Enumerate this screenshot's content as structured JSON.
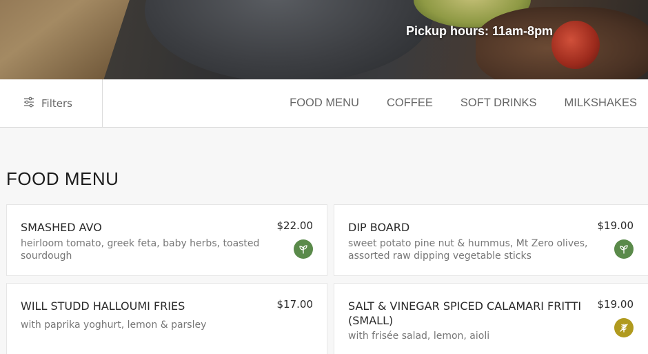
{
  "hero": {
    "pickup_text": "Pickup hours: 11am-8pm"
  },
  "nav": {
    "filters_label": "Filters",
    "tabs": [
      {
        "label": "FOOD MENU"
      },
      {
        "label": "COFFEE"
      },
      {
        "label": "SOFT DRINKS"
      },
      {
        "label": "MILKSHAKES"
      }
    ]
  },
  "section": {
    "title": "FOOD MENU"
  },
  "items": [
    {
      "name": "SMASHED AVO",
      "price": "$22.00",
      "description": "heirloom tomato, greek feta, baby herbs, toasted sourdough",
      "diet_icon": "vegetarian-leaf-icon",
      "diet_color": "#5a8a4a"
    },
    {
      "name": "DIP BOARD",
      "price": "$19.00",
      "description": "sweet potato pine nut & hummus, Mt Zero olives, assorted raw dipping vegetable sticks",
      "diet_icon": "vegetarian-leaf-icon",
      "diet_color": "#5a8a4a"
    },
    {
      "name": "WILL STUDD HALLOUMI FRIES",
      "price": "$17.00",
      "description": "with paprika yoghurt, lemon & parsley"
    },
    {
      "name": "SALT & VINEGAR SPICED CALAMARI FRITTI (SMALL)",
      "price": "$19.00",
      "description": "with frisée salad, lemon, aioli",
      "diet_icon": "gluten-free-icon",
      "diet_color": "#b09a1e"
    }
  ]
}
